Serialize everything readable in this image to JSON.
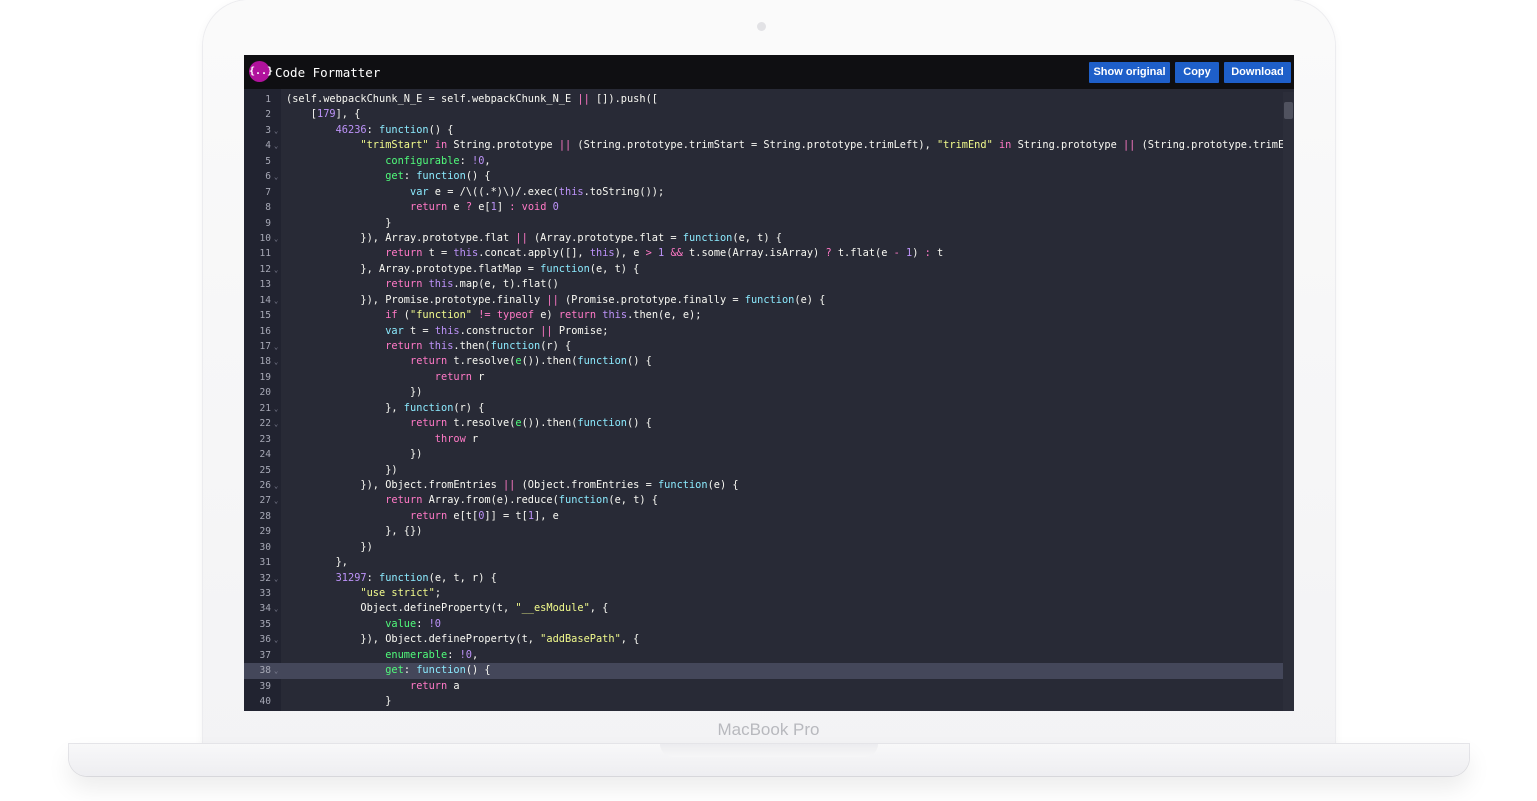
{
  "device": {
    "label": "MacBook Pro"
  },
  "app": {
    "title": "Code Formatter",
    "logo_text": "{..}",
    "accent_color": "#b0129c"
  },
  "toolbar": {
    "show_original_label": "Show original",
    "copy_label": "Copy",
    "download_label": "Download",
    "button_color": "#1e5fc9"
  },
  "editor": {
    "theme_background": "#282a36",
    "active_line": 38,
    "fold_lines": [
      3,
      4,
      6,
      10,
      12,
      14,
      17,
      18,
      21,
      22,
      26,
      27,
      32,
      34,
      36,
      38
    ],
    "lines": [
      [
        [
          "",
          "(self.webpackChunk_N_E = self.webpackChunk_N_E "
        ],
        [
          "op",
          "||"
        ],
        [
          "",
          " []).push(["
        ]
      ],
      [
        [
          "",
          "    ["
        ],
        [
          "num",
          "179"
        ],
        [
          "",
          "], {"
        ]
      ],
      [
        [
          "",
          "        "
        ],
        [
          "num",
          "46236"
        ],
        [
          "",
          ": "
        ],
        [
          "fn",
          "function"
        ],
        [
          "",
          "() {"
        ]
      ],
      [
        [
          "",
          "            "
        ],
        [
          "str",
          "\"trimStart\""
        ],
        [
          "",
          " "
        ],
        [
          "kw",
          "in"
        ],
        [
          "",
          " String.prototype "
        ],
        [
          "op",
          "||"
        ],
        [
          "",
          " (String.prototype.trimStart = String.prototype.trimLeft), "
        ],
        [
          "str",
          "\"trimEnd\""
        ],
        [
          "",
          " "
        ],
        [
          "kw",
          "in"
        ],
        [
          "",
          " String.prototype "
        ],
        [
          "op",
          "||"
        ],
        [
          "",
          " (String.prototype.trimEnd = String.prototype.trimRight),"
        ]
      ],
      [
        [
          "",
          "                "
        ],
        [
          "prop",
          "configurable"
        ],
        [
          "",
          ": "
        ],
        [
          "num",
          "!0"
        ],
        [
          "",
          ","
        ]
      ],
      [
        [
          "",
          "                "
        ],
        [
          "prop",
          "get"
        ],
        [
          "",
          ": "
        ],
        [
          "fn",
          "function"
        ],
        [
          "",
          "() {"
        ]
      ],
      [
        [
          "",
          "                    "
        ],
        [
          "fn",
          "var"
        ],
        [
          "",
          " e = /\\((.*)\\)/.exec("
        ],
        [
          "num",
          "this"
        ],
        [
          "",
          ".toString());"
        ]
      ],
      [
        [
          "",
          "                    "
        ],
        [
          "kw",
          "return"
        ],
        [
          "",
          " e "
        ],
        [
          "op",
          "?"
        ],
        [
          "",
          " e["
        ],
        [
          "num",
          "1"
        ],
        [
          "",
          "] "
        ],
        [
          "op",
          ":"
        ],
        [
          "",
          " "
        ],
        [
          "kw",
          "void"
        ],
        [
          "",
          " "
        ],
        [
          "num",
          "0"
        ]
      ],
      [
        [
          "",
          "                }"
        ]
      ],
      [
        [
          "",
          "            }), Array.prototype.flat "
        ],
        [
          "op",
          "||"
        ],
        [
          "",
          " (Array.prototype.flat = "
        ],
        [
          "fn",
          "function"
        ],
        [
          "",
          "(e, t) {"
        ]
      ],
      [
        [
          "",
          "                "
        ],
        [
          "kw",
          "return"
        ],
        [
          "",
          " t = "
        ],
        [
          "num",
          "this"
        ],
        [
          "",
          ".concat.apply([], "
        ],
        [
          "num",
          "this"
        ],
        [
          "",
          "), e "
        ],
        [
          "op",
          ">"
        ],
        [
          "",
          " "
        ],
        [
          "num",
          "1"
        ],
        [
          "",
          " "
        ],
        [
          "op",
          "&&"
        ],
        [
          "",
          " t.some(Array.isArray) "
        ],
        [
          "op",
          "?"
        ],
        [
          "",
          " t.flat(e "
        ],
        [
          "op",
          "-"
        ],
        [
          "",
          " "
        ],
        [
          "num",
          "1"
        ],
        [
          "",
          ") "
        ],
        [
          "op",
          ":"
        ],
        [
          "",
          " t"
        ]
      ],
      [
        [
          "",
          "            }, Array.prototype.flatMap = "
        ],
        [
          "fn",
          "function"
        ],
        [
          "",
          "(e, t) {"
        ]
      ],
      [
        [
          "",
          "                "
        ],
        [
          "kw",
          "return"
        ],
        [
          "",
          " "
        ],
        [
          "num",
          "this"
        ],
        [
          "",
          ".map(e, t).flat()"
        ]
      ],
      [
        [
          "",
          "            }), Promise.prototype.finally "
        ],
        [
          "op",
          "||"
        ],
        [
          "",
          " (Promise.prototype.finally = "
        ],
        [
          "fn",
          "function"
        ],
        [
          "",
          "(e) {"
        ]
      ],
      [
        [
          "",
          "                "
        ],
        [
          "kw",
          "if"
        ],
        [
          "",
          " ("
        ],
        [
          "str",
          "\"function\""
        ],
        [
          "",
          " "
        ],
        [
          "op",
          "!="
        ],
        [
          "",
          " "
        ],
        [
          "kw",
          "typeof"
        ],
        [
          "",
          " e) "
        ],
        [
          "kw",
          "return"
        ],
        [
          "",
          " "
        ],
        [
          "num",
          "this"
        ],
        [
          "",
          ".then(e, e);"
        ]
      ],
      [
        [
          "",
          "                "
        ],
        [
          "fn",
          "var"
        ],
        [
          "",
          " t = "
        ],
        [
          "num",
          "this"
        ],
        [
          "",
          ".constructor "
        ],
        [
          "op",
          "||"
        ],
        [
          "",
          " Promise;"
        ]
      ],
      [
        [
          "",
          "                "
        ],
        [
          "kw",
          "return"
        ],
        [
          "",
          " "
        ],
        [
          "num",
          "this"
        ],
        [
          "",
          ".then("
        ],
        [
          "fn",
          "function"
        ],
        [
          "",
          "(r) {"
        ]
      ],
      [
        [
          "",
          "                    "
        ],
        [
          "kw",
          "return"
        ],
        [
          "",
          " t.resolve("
        ],
        [
          "prop",
          "e"
        ],
        [
          "",
          "()).then("
        ],
        [
          "fn",
          "function"
        ],
        [
          "",
          "() {"
        ]
      ],
      [
        [
          "",
          "                        "
        ],
        [
          "kw",
          "return"
        ],
        [
          "",
          " r"
        ]
      ],
      [
        [
          "",
          "                    })"
        ]
      ],
      [
        [
          "",
          "                }, "
        ],
        [
          "fn",
          "function"
        ],
        [
          "",
          "(r) {"
        ]
      ],
      [
        [
          "",
          "                    "
        ],
        [
          "kw",
          "return"
        ],
        [
          "",
          " t.resolve("
        ],
        [
          "prop",
          "e"
        ],
        [
          "",
          "()).then("
        ],
        [
          "fn",
          "function"
        ],
        [
          "",
          "() {"
        ]
      ],
      [
        [
          "",
          "                        "
        ],
        [
          "kw",
          "throw"
        ],
        [
          "",
          " r"
        ]
      ],
      [
        [
          "",
          "                    })"
        ]
      ],
      [
        [
          "",
          "                })"
        ]
      ],
      [
        [
          "",
          "            }), Object.fromEntries "
        ],
        [
          "op",
          "||"
        ],
        [
          "",
          " (Object.fromEntries = "
        ],
        [
          "fn",
          "function"
        ],
        [
          "",
          "(e) {"
        ]
      ],
      [
        [
          "",
          "                "
        ],
        [
          "kw",
          "return"
        ],
        [
          "",
          " Array.from(e).reduce("
        ],
        [
          "fn",
          "function"
        ],
        [
          "",
          "(e, t) {"
        ]
      ],
      [
        [
          "",
          "                    "
        ],
        [
          "kw",
          "return"
        ],
        [
          "",
          " e[t["
        ],
        [
          "num",
          "0"
        ],
        [
          "",
          "]] = t["
        ],
        [
          "num",
          "1"
        ],
        [
          "",
          "], e"
        ]
      ],
      [
        [
          "",
          "                }, {})"
        ]
      ],
      [
        [
          "",
          "            })"
        ]
      ],
      [
        [
          "",
          "        },"
        ]
      ],
      [
        [
          "",
          "        "
        ],
        [
          "num",
          "31297"
        ],
        [
          "",
          ": "
        ],
        [
          "fn",
          "function"
        ],
        [
          "",
          "(e, t, r) {"
        ]
      ],
      [
        [
          "",
          "            "
        ],
        [
          "str",
          "\"use strict\""
        ],
        [
          "",
          ";"
        ]
      ],
      [
        [
          "",
          "            Object.defineProperty(t, "
        ],
        [
          "str",
          "\"__esModule\""
        ],
        [
          "",
          ", {"
        ]
      ],
      [
        [
          "",
          "                "
        ],
        [
          "prop",
          "value"
        ],
        [
          "",
          ": "
        ],
        [
          "num",
          "!0"
        ]
      ],
      [
        [
          "",
          "            }), Object.defineProperty(t, "
        ],
        [
          "str",
          "\"addBasePath\""
        ],
        [
          "",
          ", {"
        ]
      ],
      [
        [
          "",
          "                "
        ],
        [
          "prop",
          "enumerable"
        ],
        [
          "",
          ": "
        ],
        [
          "num",
          "!0"
        ],
        [
          "",
          ","
        ]
      ],
      [
        [
          "",
          "                "
        ],
        [
          "prop",
          "get"
        ],
        [
          "",
          ": "
        ],
        [
          "fn",
          "function"
        ],
        [
          "",
          "() {"
        ]
      ],
      [
        [
          "",
          "                    "
        ],
        [
          "kw",
          "return"
        ],
        [
          "",
          " a"
        ]
      ],
      [
        [
          "",
          "                }"
        ]
      ]
    ]
  }
}
